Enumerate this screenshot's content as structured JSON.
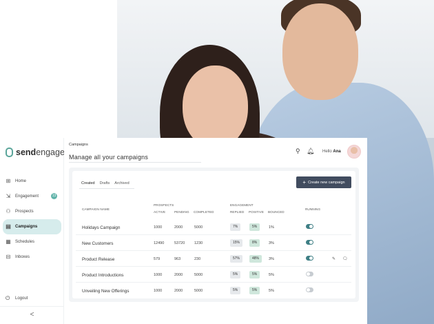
{
  "brand": {
    "prefix": "send",
    "suffix": "engage"
  },
  "sidebar": {
    "items": [
      {
        "label": "Home",
        "icon": "grid-icon"
      },
      {
        "label": "Engagement",
        "icon": "funnel-icon",
        "badge": "13"
      },
      {
        "label": "Prospects",
        "icon": "users-icon"
      },
      {
        "label": "Campaigns",
        "icon": "document-icon",
        "active": true
      },
      {
        "label": "Schedules",
        "icon": "calendar-icon"
      },
      {
        "label": "Inboxes",
        "icon": "inbox-icon"
      }
    ],
    "logout": "Logout",
    "collapse": "<"
  },
  "header": {
    "breadcrumb": "Campaigns",
    "title": "Manage all your campaigns",
    "greeting": "Hello",
    "user": "Ana"
  },
  "tabs": [
    "Created",
    "Drafts",
    "Archived"
  ],
  "create_button": "Create new campaign",
  "columns": {
    "campaign_name": "Campaign Name",
    "prospects": "Prospects",
    "active": "Active",
    "pending": "Pending",
    "completed": "Completed",
    "engagement": "Engagement",
    "replied": "Replied",
    "positive": "Positive",
    "bounced": "Bounced",
    "running": "Running"
  },
  "rows": [
    {
      "name": "Holidays Campaign",
      "active": "1000",
      "pending": "2000",
      "completed": "5000",
      "replied": "7%",
      "positive": "5%",
      "bounced": "1%",
      "running": true
    },
    {
      "name": "New Customers",
      "active": "12490",
      "pending": "53720",
      "completed": "1230",
      "replied": "15%",
      "positive": "8%",
      "bounced": "3%",
      "running": true
    },
    {
      "name": "Product Release",
      "active": "579",
      "pending": "963",
      "completed": "230",
      "replied": "57%",
      "positive": "48%",
      "bounced": "3%",
      "running": true,
      "actions": true
    },
    {
      "name": "Product Introductions",
      "active": "1000",
      "pending": "2000",
      "completed": "5000",
      "replied": "5%",
      "positive": "5%",
      "bounced": "5%",
      "running": false
    },
    {
      "name": "Unveiling New Offerings",
      "active": "1000",
      "pending": "2000",
      "completed": "5000",
      "replied": "5%",
      "positive": "5%",
      "bounced": "5%",
      "running": false
    }
  ],
  "colors": {
    "accent": "#5aa59a",
    "active_nav": "#d6ecec",
    "button": "#414c5f",
    "toggle_on": "#3f7f85",
    "positive_pill": "#cfe7dc"
  }
}
